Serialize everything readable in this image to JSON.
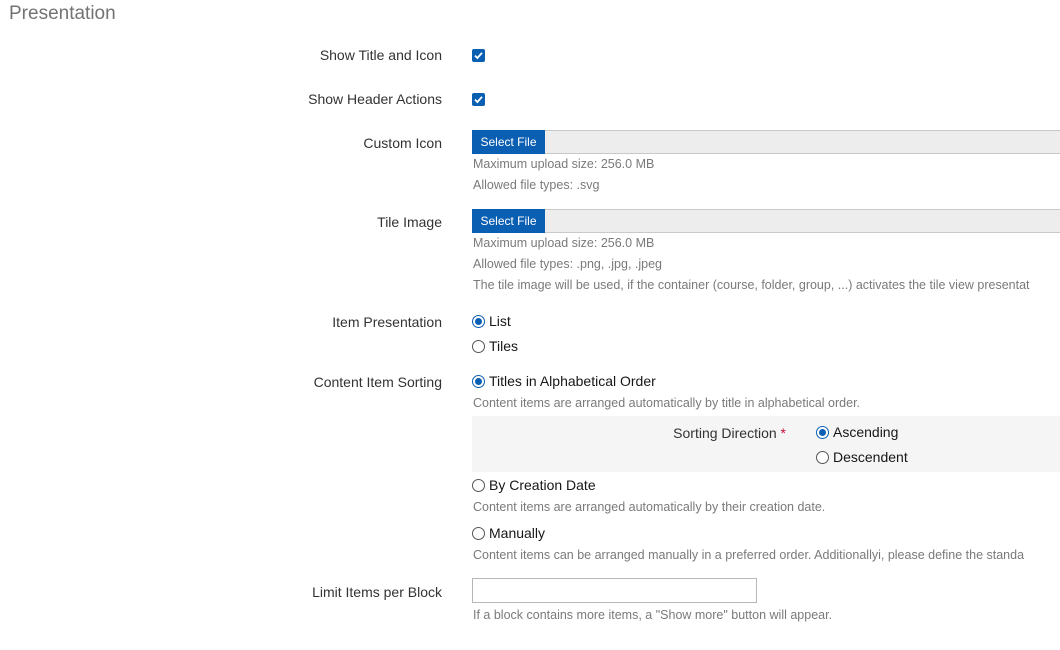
{
  "section": {
    "title": "Presentation"
  },
  "show_title_icon": {
    "label": "Show Title and Icon",
    "checked": true
  },
  "show_header_actions": {
    "label": "Show Header Actions",
    "checked": true
  },
  "custom_icon": {
    "label": "Custom Icon",
    "button": "Select File",
    "max_size": "Maximum upload size: 256.0 MB",
    "types": "Allowed file types: .svg"
  },
  "tile_image": {
    "label": "Tile Image",
    "button": "Select File",
    "max_size": "Maximum upload size: 256.0 MB",
    "types": "Allowed file types: .png, .jpg, .jpeg",
    "info": "The tile image will be used, if the container (course, folder, group, ...) activates the tile view presentat"
  },
  "item_presentation": {
    "label": "Item Presentation",
    "options": [
      "List",
      "Tiles"
    ],
    "selected": "List"
  },
  "sorting": {
    "label": "Content Item Sorting",
    "alpha": {
      "label": "Titles in Alphabetical Order",
      "help": "Content items are arranged automatically by title in alphabetical order."
    },
    "direction": {
      "label": "Sorting Direction",
      "required_mark": "*",
      "options": [
        "Ascending",
        "Descendent"
      ],
      "selected": "Ascending"
    },
    "creation": {
      "label": "By Creation Date",
      "help": "Content items are arranged automatically by their creation date."
    },
    "manual": {
      "label": "Manually",
      "help": "Content items can be arranged manually in a preferred order. Additionallyi, please define the standa"
    },
    "selected": "alpha"
  },
  "limit": {
    "label": "Limit Items per Block",
    "value": "",
    "help": "If a block contains more items, a \"Show more\" button will appear."
  }
}
